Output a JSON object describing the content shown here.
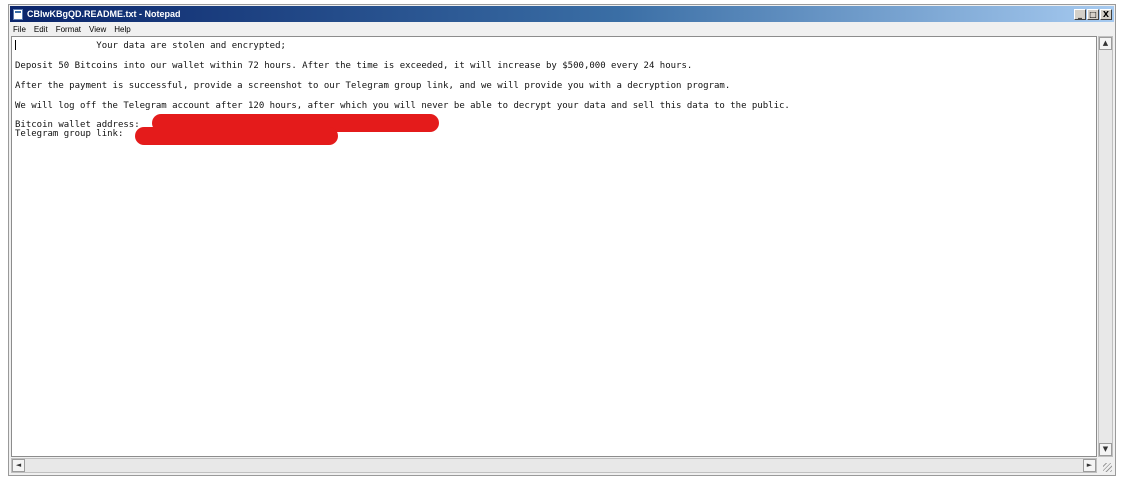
{
  "window": {
    "title": "CBlwKBgQD.README.txt - Notepad",
    "caption_buttons": {
      "minimize": "_",
      "maximize": "□",
      "close": "X"
    }
  },
  "menu": [
    "File",
    "Edit",
    "Format",
    "View",
    "Help"
  ],
  "document": {
    "lines": [
      "               Your data are stolen and encrypted;",
      "Deposit 50 Bitcoins into our wallet within 72 hours. After the time is exceeded, it will increase by $500,000 every 24 hours.",
      "After the payment is successful, provide a screenshot to our Telegram group link, and we will provide you with a decryption program.",
      "We will log off the Telegram account after 120 hours, after which you will never be able to decrypt your data and sell this data to the public.",
      "Bitcoin wallet address:",
      "Telegram group link:"
    ],
    "redaction_color": "#e41b1b"
  },
  "scrollbars": {
    "up": "▲",
    "down": "▼",
    "left": "◄",
    "right": "►"
  }
}
